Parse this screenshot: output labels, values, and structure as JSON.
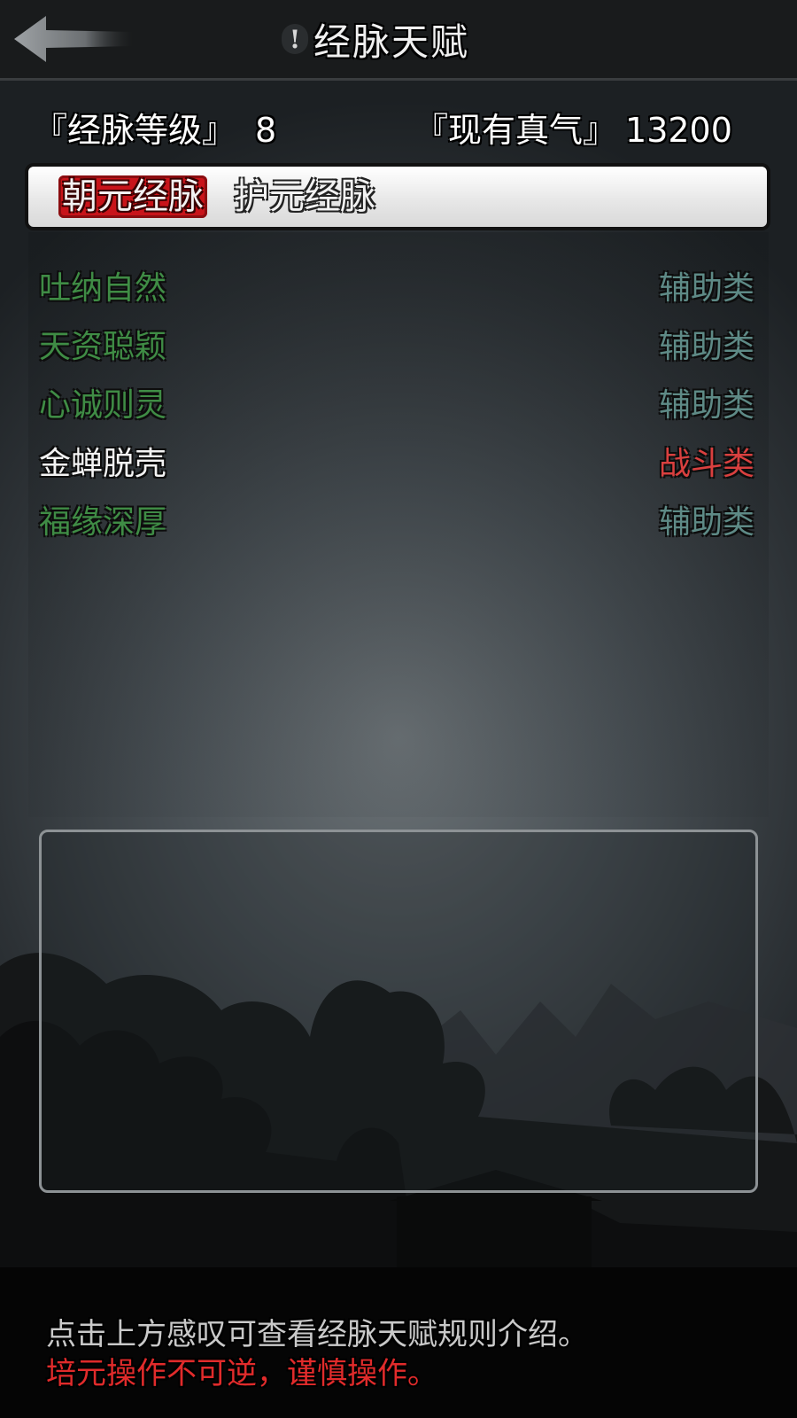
{
  "header": {
    "title": "经脉天赋",
    "info_icon": "exclamation-icon",
    "back_icon": "back-arrow-icon"
  },
  "stats": {
    "level_label": "『经脉等级』",
    "level_value": "8",
    "qi_label": "『现有真气』",
    "qi_value": "13200"
  },
  "tabs": [
    {
      "label": "朝元经脉",
      "active": true
    },
    {
      "label": "护元经脉",
      "active": false
    }
  ],
  "talents": [
    {
      "name": "吐纳自然",
      "type": "辅助类",
      "name_color": "green",
      "type_color": "teal"
    },
    {
      "name": "天资聪颖",
      "type": "辅助类",
      "name_color": "green",
      "type_color": "teal"
    },
    {
      "name": "心诚则灵",
      "type": "辅助类",
      "name_color": "green",
      "type_color": "teal"
    },
    {
      "name": "金蝉脱壳",
      "type": "战斗类",
      "name_color": "white",
      "type_color": "red"
    },
    {
      "name": "福缘深厚",
      "type": "辅助类",
      "name_color": "green",
      "type_color": "teal"
    }
  ],
  "footer": {
    "hint": "点击上方感叹可查看经脉天赋规则介绍。",
    "warning": "培元操作不可逆，谨慎操作。"
  },
  "colors": {
    "active_tab": "#c8141a",
    "green_text": "#3f8c45",
    "teal_text": "#5e8a86",
    "red_text": "#d9403f",
    "warning_text": "#e12b2b"
  }
}
